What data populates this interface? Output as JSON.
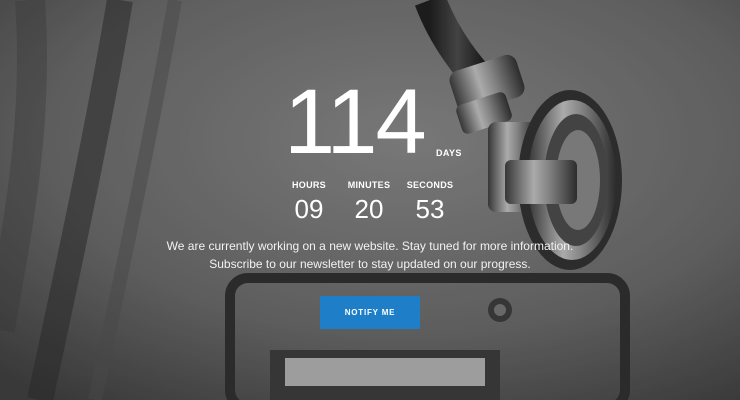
{
  "countdown": {
    "days_value": "114",
    "days_label": "DAYS",
    "hours_label": "HOURS",
    "hours_value": "09",
    "minutes_label": "MINUTES",
    "minutes_value": "20",
    "seconds_label": "SECONDS",
    "seconds_value": "53"
  },
  "message": {
    "line1": "We are currently working on a new website. Stay tuned for more information.",
    "line2": "Subscribe to our newsletter to stay updated on our progress."
  },
  "cta": {
    "label": "NOTIFY ME",
    "color": "#1e7fc8"
  },
  "background": {
    "icon": "stethoscope-photo"
  }
}
